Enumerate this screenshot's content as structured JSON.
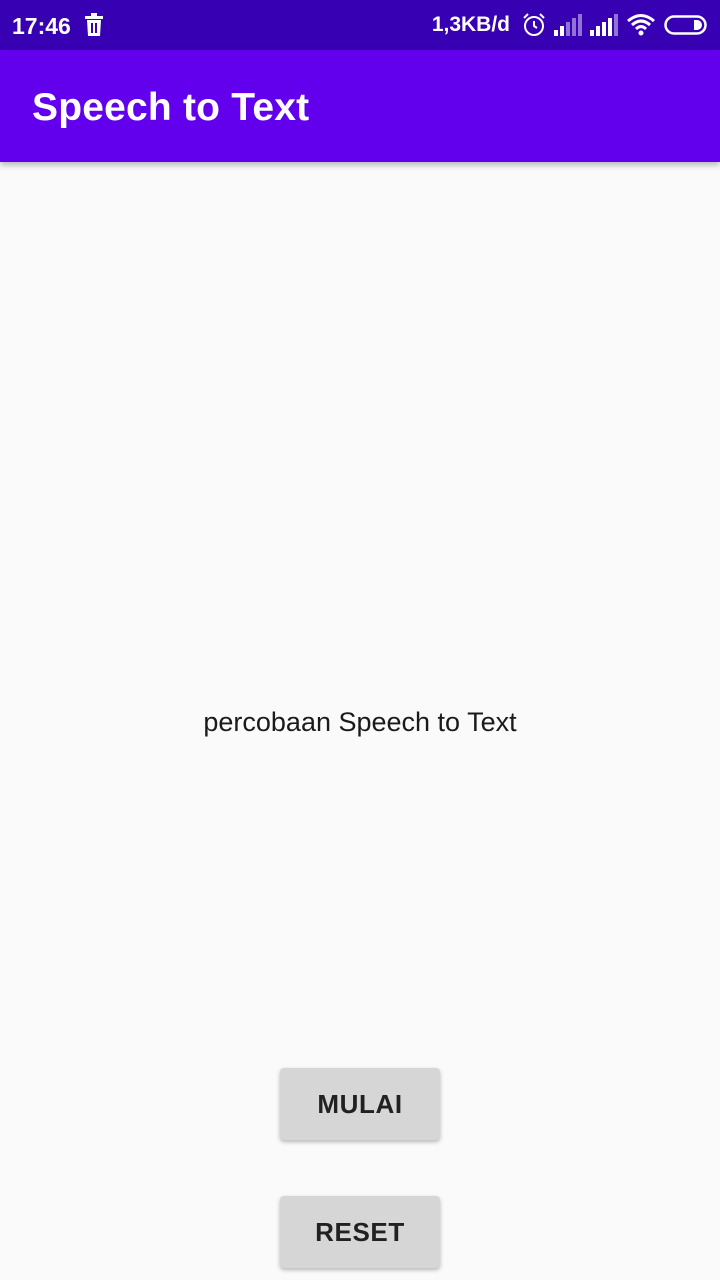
{
  "status_bar": {
    "time": "17:46",
    "net_speed": "1,3KB/d",
    "icons": [
      "trash-icon",
      "alarm-icon",
      "signal-icon",
      "signal-icon",
      "wifi-icon",
      "battery-icon"
    ]
  },
  "app_bar": {
    "title": "Speech to Text"
  },
  "main": {
    "result_text": "percobaan Speech to Text"
  },
  "buttons": {
    "start_label": "MULAI",
    "reset_label": "RESET"
  },
  "colors": {
    "status_bar": "#3700b3",
    "app_bar": "#6200ee",
    "background": "#fafafa",
    "button": "#d6d6d6"
  }
}
